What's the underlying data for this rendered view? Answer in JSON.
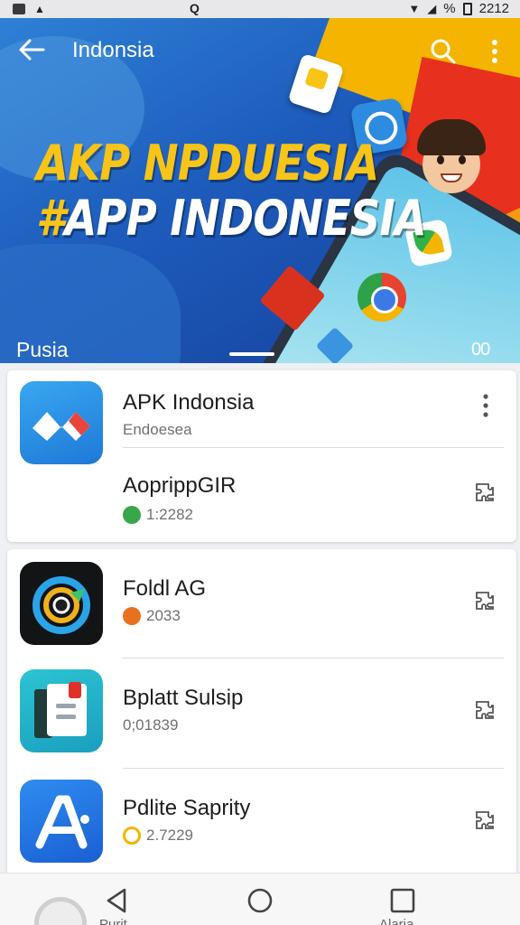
{
  "status_bar": {
    "center_glyph": "Q",
    "battery_text": "%",
    "time": "2212"
  },
  "header": {
    "title": "Indonsia"
  },
  "hero": {
    "line1": "AKP NPDUESIA",
    "line2_hash": "#",
    "line2": "APP INDONESIA",
    "label": "Pusia",
    "page_count": "00"
  },
  "featured": {
    "name": "APK Indonsia",
    "subtitle": "Endoesea",
    "second_name": "AoprippGIR",
    "second_meta": "1:2282"
  },
  "apps": [
    {
      "name": "Foldl AG",
      "meta": "2033",
      "accent": "#e8701e"
    },
    {
      "name": "Bplatt Sulsip",
      "meta": "0;01839",
      "accent": ""
    },
    {
      "name": "Pdlite Saprity",
      "meta": "2.7229",
      "accent": "#f2b600"
    }
  ],
  "colors": {
    "primary": "#1d5bbb",
    "accent_yellow": "#f7c417",
    "accent_red": "#e8301e"
  },
  "navbar": {
    "left_label": "Purit",
    "right_label": "Alaria"
  }
}
